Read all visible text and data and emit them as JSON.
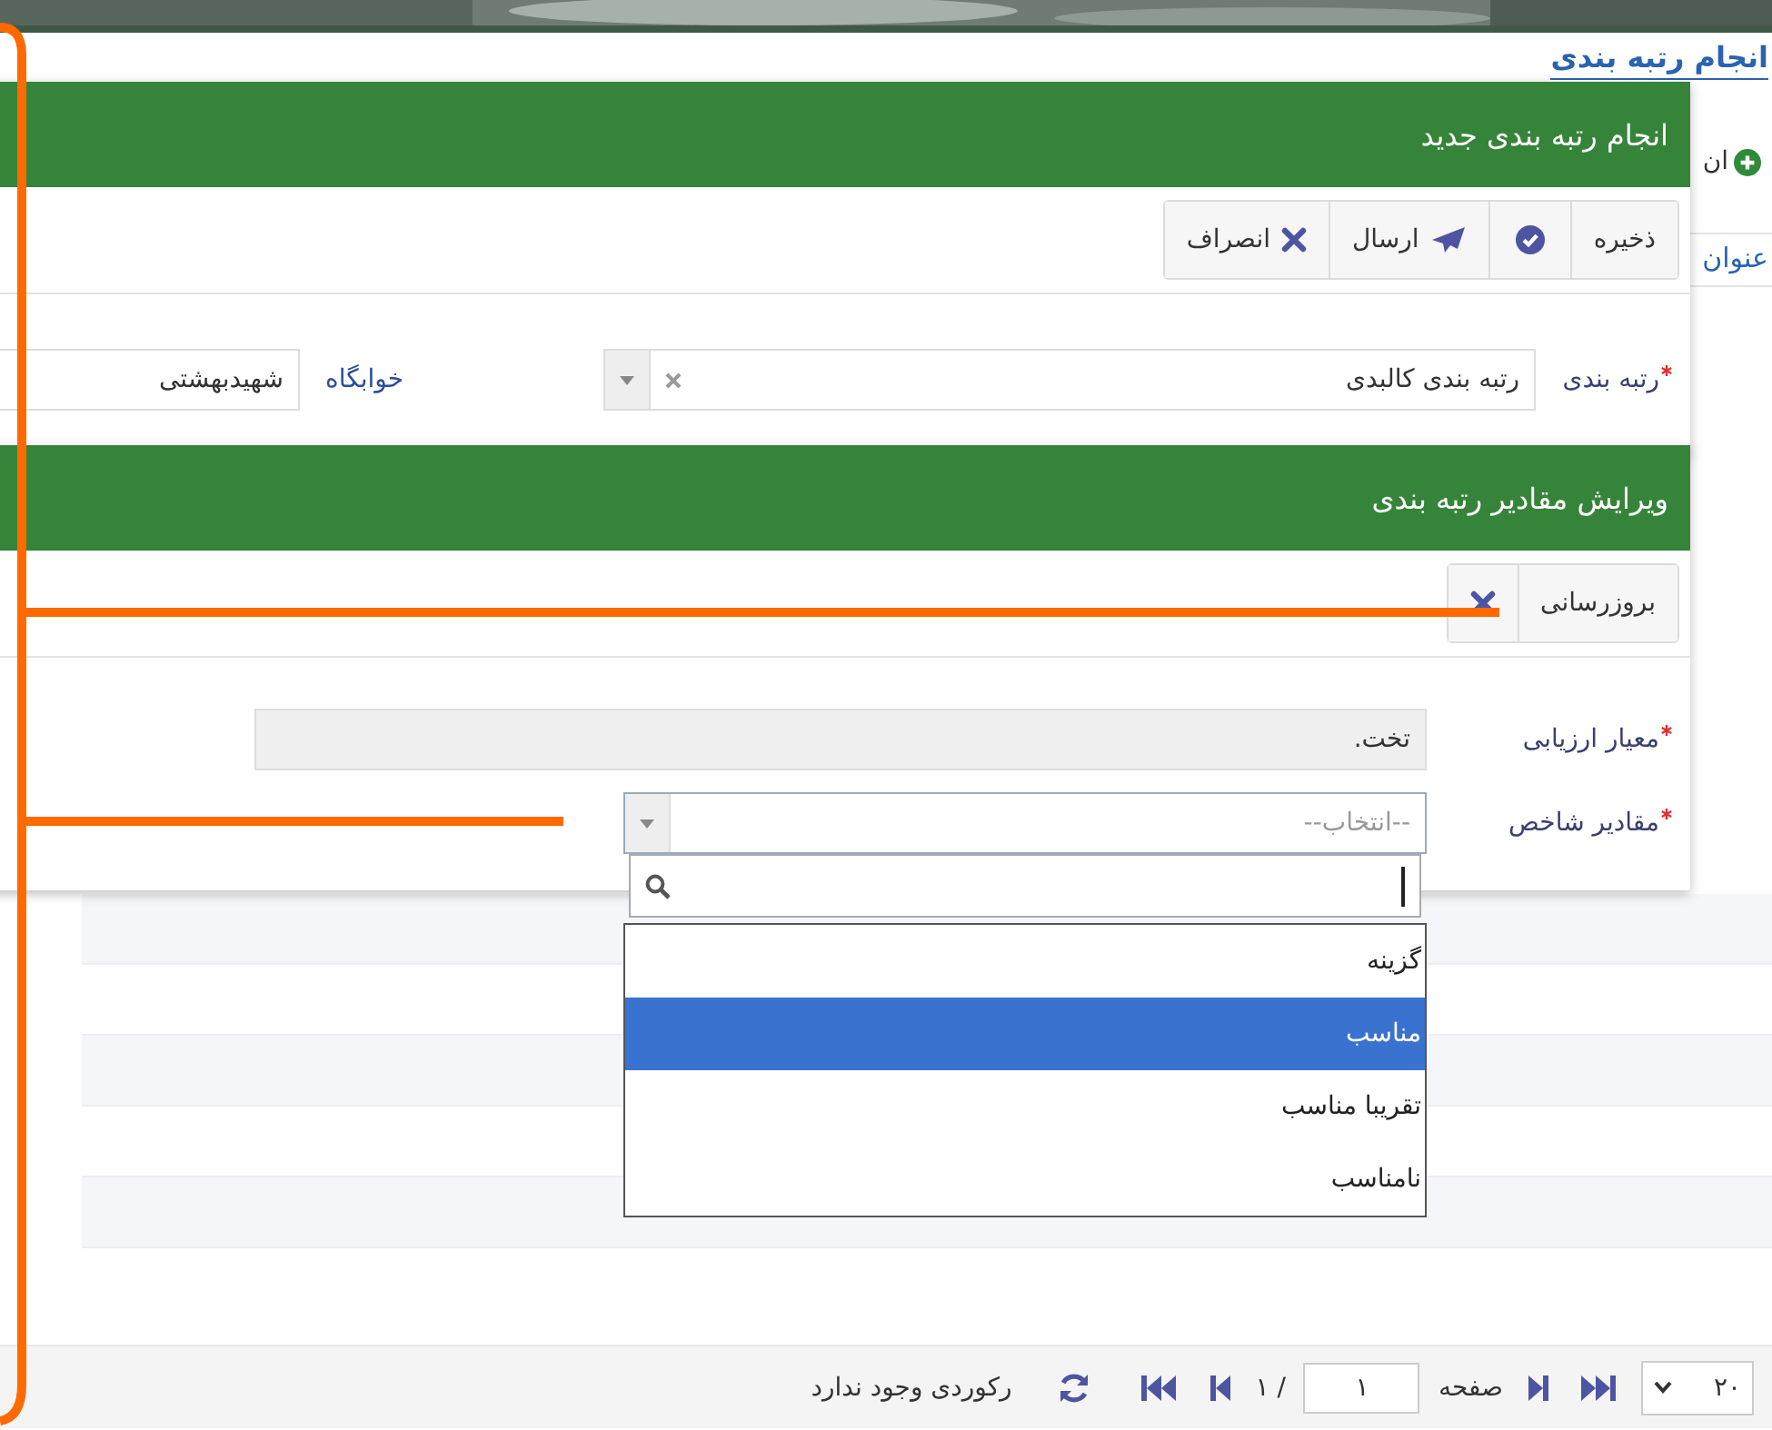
{
  "page": {
    "title": "انجام رتبه بندی",
    "toolbar_button": {
      "label": "ان"
    },
    "table": {
      "columns": [
        "عنوان"
      ]
    }
  },
  "dialogs": [
    {
      "title": "انجام رتبه بندی جدید",
      "buttons": [
        {
          "kind": "plain",
          "label": "ذخیره"
        },
        {
          "kind": "check"
        },
        {
          "kind": "send",
          "label": "ارسال"
        },
        {
          "kind": "cancel",
          "label": "انصراف"
        }
      ],
      "fields": [
        {
          "kind": "select",
          "label": "رتبه بندی",
          "required": true,
          "value": "رتبه بندی کالبدی",
          "clearable": true,
          "expanded": false
        },
        {
          "kind": "text",
          "label": "خوابگاه",
          "required": false,
          "value": "شهیدبهشتی",
          "disabled": false
        }
      ]
    },
    {
      "title": "ویرایش مقادیر رتبه بندی",
      "buttons": [
        {
          "kind": "plain",
          "label": "بروزرسانی"
        },
        {
          "kind": "cancel"
        }
      ],
      "fields": [
        {
          "kind": "text",
          "label": "معیار ارزیابی",
          "required": true,
          "value": "تخت.",
          "disabled": true
        },
        {
          "kind": "select",
          "label": "مقادیر شاخص",
          "required": true,
          "placeholder": "--انتخاب--",
          "clearable": false,
          "expanded": true,
          "options": [
            {
              "label": "گزینه",
              "selected": false
            },
            {
              "label": "مناسب",
              "selected": true
            },
            {
              "label": "تقریبا مناسب",
              "selected": false
            },
            {
              "label": "نامناسب",
              "selected": false
            }
          ]
        }
      ]
    }
  ],
  "pager": {
    "page_size": "۲۰",
    "page_label": "صفحه",
    "page": "۱",
    "page_count": "/ ۱",
    "status": "رکوردی وجود ندارد"
  }
}
